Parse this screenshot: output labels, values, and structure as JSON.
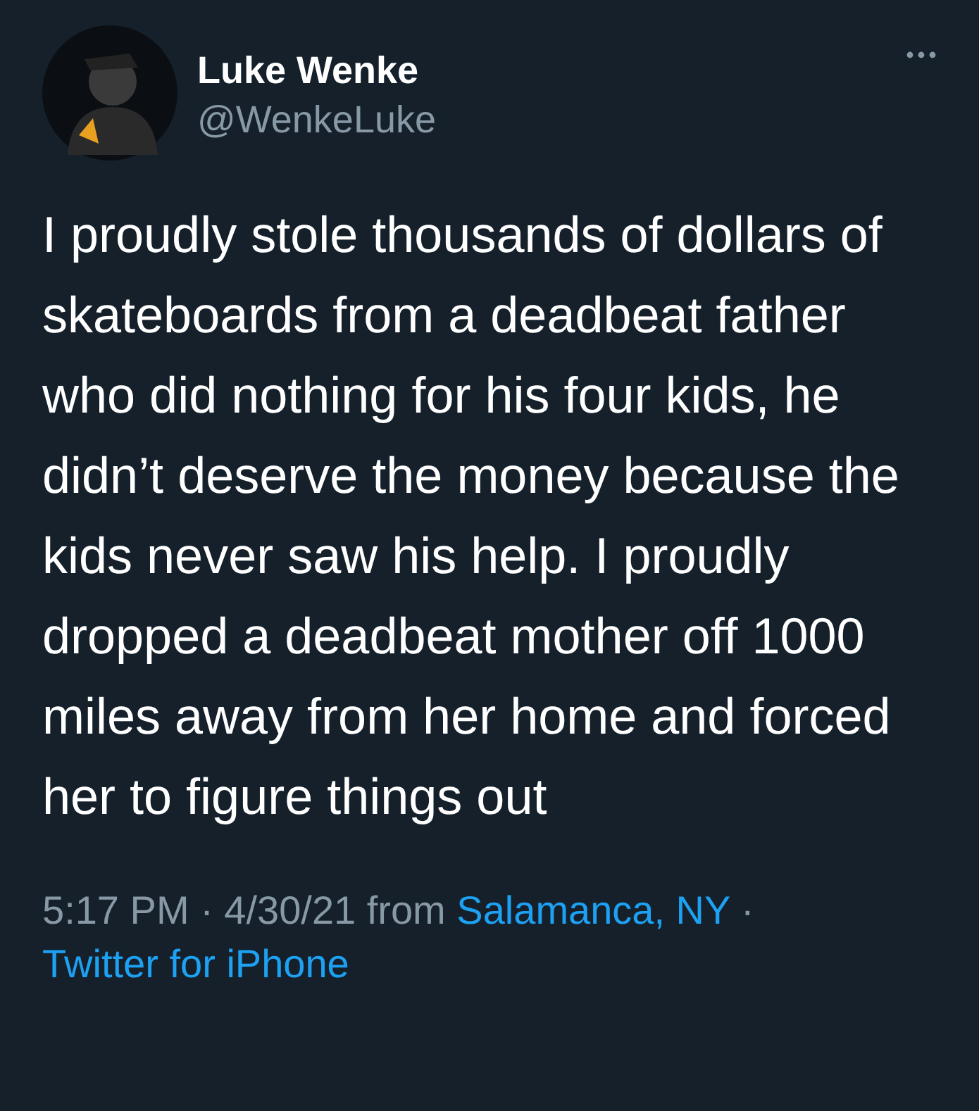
{
  "author": {
    "name": "Luke Wenke",
    "handle": "@WenkeLuke"
  },
  "tweet": {
    "text": "I proudly stole thousands of dollars of skateboards from a deadbeat father who did nothing for his four kids, he didn’t deserve the money because the kids never saw his help. I proudly dropped a deadbeat mother off 1000 miles away from her home and forced her to figure things out"
  },
  "meta": {
    "time": "5:17 PM",
    "separator_1": "·",
    "date": "4/30/21",
    "from": "from",
    "location": "Salamanca, NY",
    "separator_2": "·",
    "source": "Twitter for iPhone"
  }
}
